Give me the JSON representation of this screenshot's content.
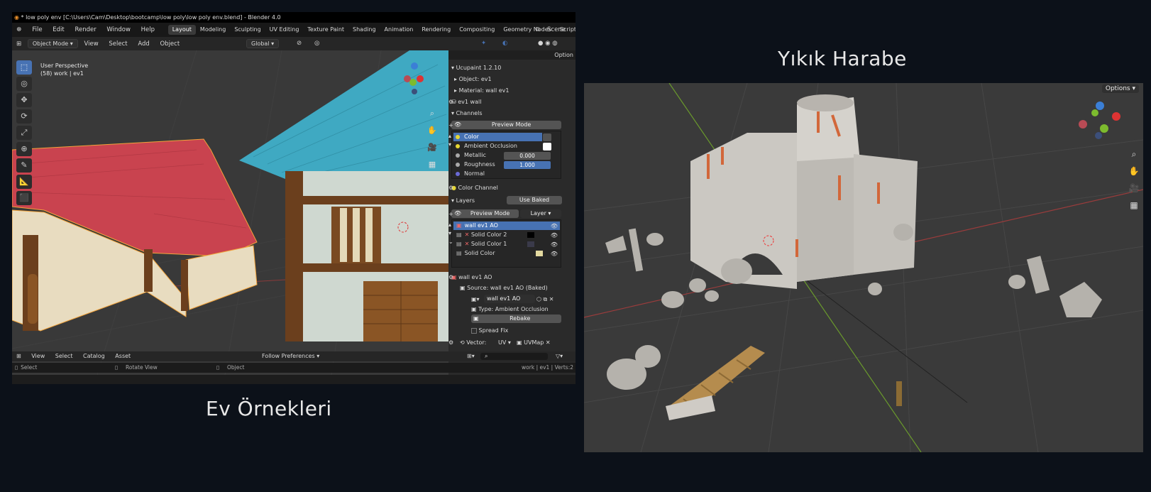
{
  "left_screenshot": {
    "title_bar": "* low poly env [C:\\Users\\Cam\\Desktop\\bootcamp\\low poly\\low poly env.blend] - Blender 4.0",
    "menu": [
      "File",
      "Edit",
      "Render",
      "Window",
      "Help"
    ],
    "workspaces": [
      "Layout",
      "Modeling",
      "Sculpting",
      "UV Editing",
      "Texture Paint",
      "Shading",
      "Animation",
      "Rendering",
      "Compositing",
      "Geometry Nodes",
      "Scripting"
    ],
    "active_workspace": "Layout",
    "scene_label": "Scene",
    "header": {
      "mode": "Object Mode",
      "items": [
        "View",
        "Select",
        "Add",
        "Object"
      ],
      "transform": "Global"
    },
    "options_label": "Option",
    "viewport_info": {
      "line1": "User Perspective",
      "line2": "(58) work | ev1"
    },
    "npanel": {
      "addon_title": "Ucupaint 1.2.10",
      "object": "Object: ev1",
      "material": "Material: wall ev1",
      "image_name": "ev1 wall",
      "channels_header": "Channels",
      "preview_mode": "Preview Mode",
      "channels": [
        {
          "name": "Color",
          "value": ""
        },
        {
          "name": "Ambient Occlusion",
          "value": ""
        },
        {
          "name": "Metallic",
          "value": "0.000"
        },
        {
          "name": "Roughness",
          "value": "1.000"
        },
        {
          "name": "Normal",
          "value": ""
        }
      ],
      "color_channel": "Color Channel",
      "layers_header": "Layers",
      "use_baked": "Use Baked",
      "layers_preview": "Preview Mode",
      "layer_dropdown": "Layer",
      "layers": [
        "wall ev1 AO",
        "Solid Color 2",
        "Solid Color 1",
        "Solid Color"
      ],
      "layer_detail": "wall ev1 AO",
      "source": "Source: wall ev1 AO (Baked)",
      "image_field": "wall ev1 AO",
      "type": "Type: Ambient Occlusion",
      "rebake": "Rebake",
      "spread_fix": "Spread Fix",
      "vector_label": "Vector:",
      "vector_uv": "UV",
      "uvmap": "UVMap"
    },
    "bottom_header": {
      "items": [
        "View",
        "Select",
        "Catalog",
        "Asset"
      ],
      "follow": "Follow Preferences"
    },
    "status_bar": {
      "select": "Select",
      "rotate": "Rotate View",
      "object": "Object",
      "stats": "work | ev1 | Verts:2"
    },
    "colors": {
      "accent": "#4772b3",
      "roof_red": "#c9434f",
      "roof_blue": "#3fa9c2",
      "wood": "#6b3f1d",
      "wall": "#e8dcc0"
    }
  },
  "captions": {
    "left": "Ev Örnekleri",
    "right": "Yıkık Harabe"
  },
  "right_screenshot": {
    "options_label": "Options"
  }
}
